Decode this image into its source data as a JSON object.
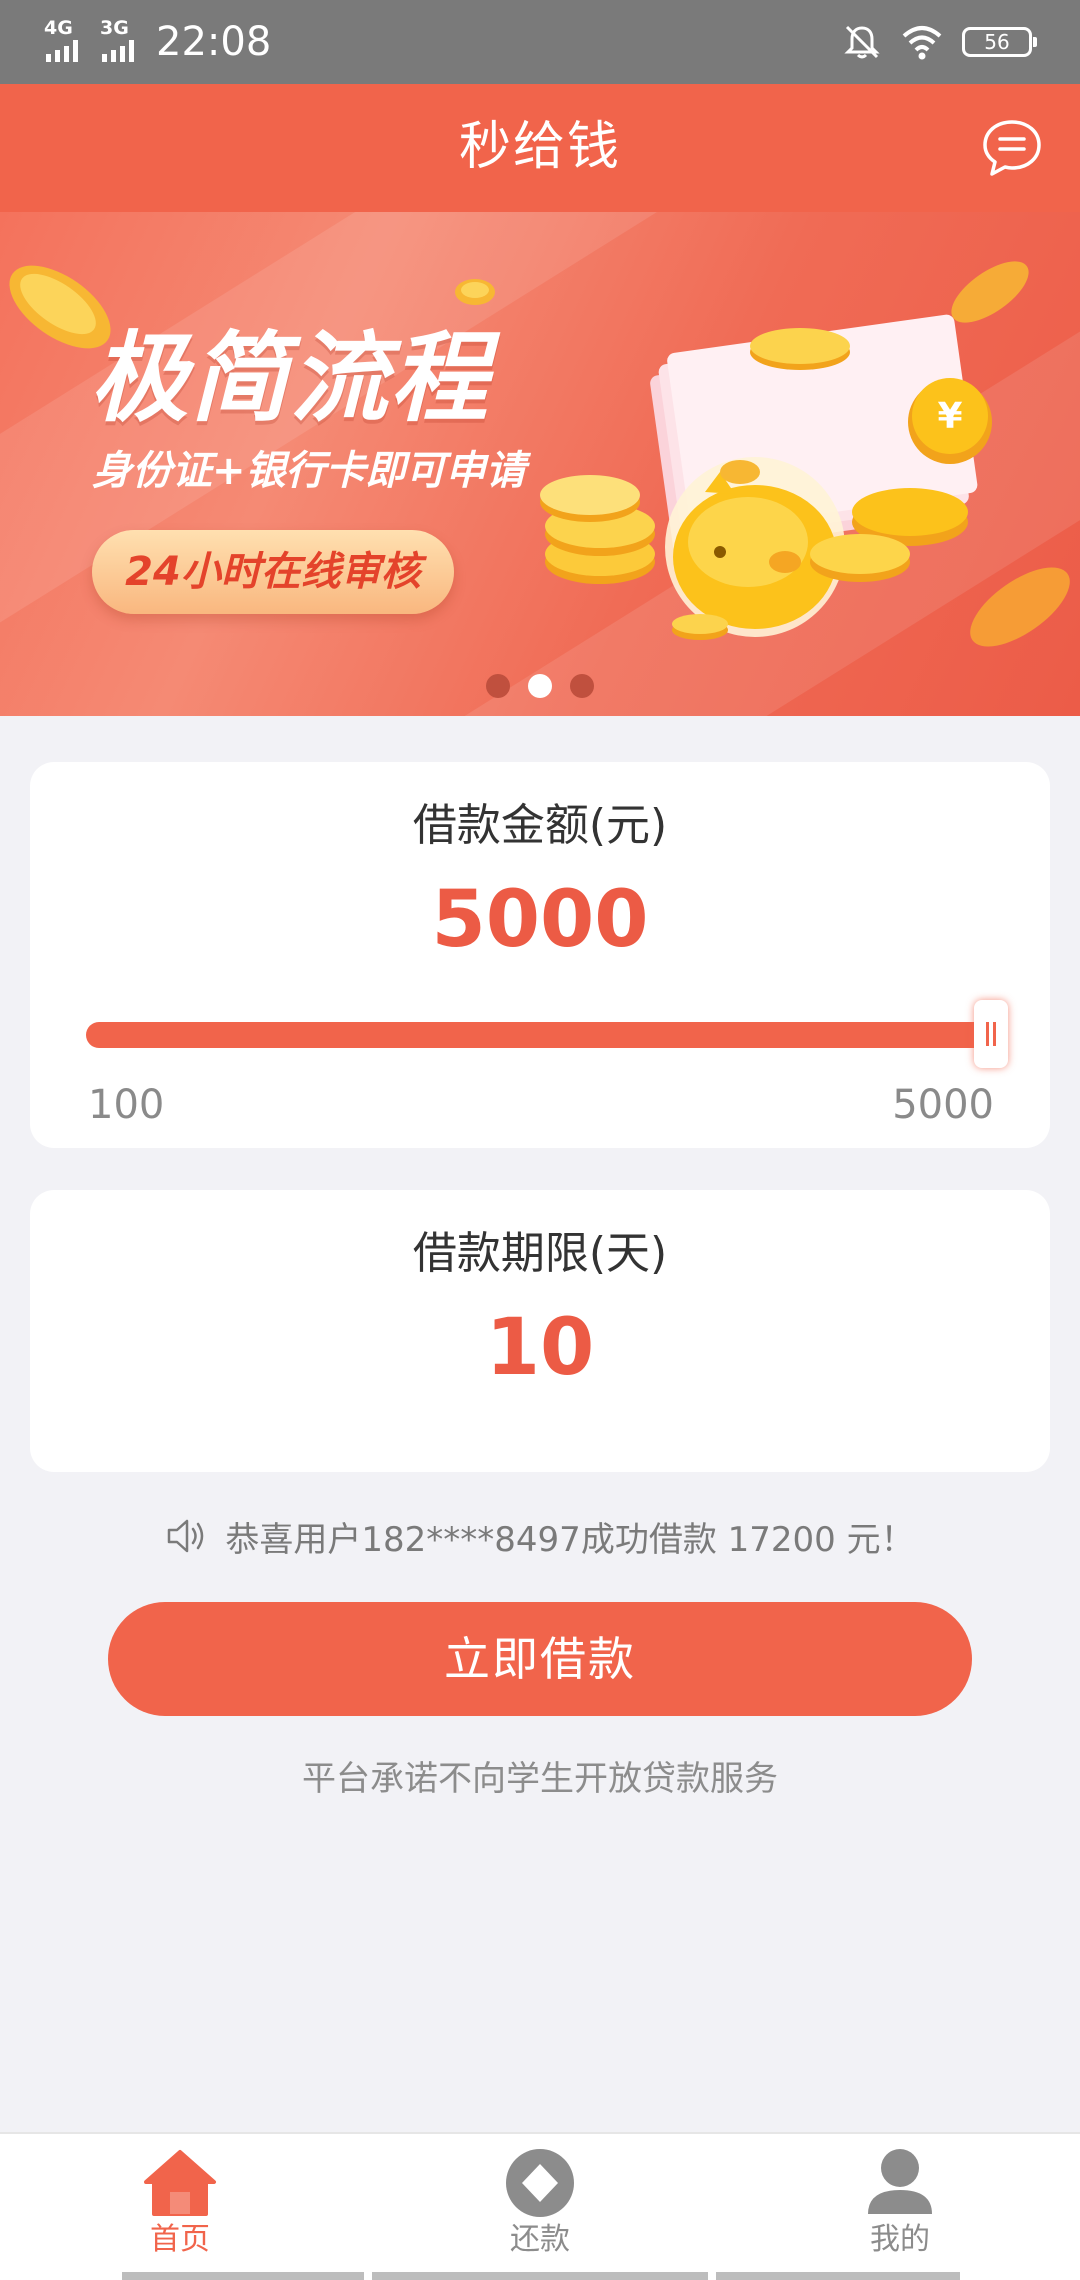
{
  "status_bar": {
    "network_1": "4G",
    "network_2": "3G",
    "time": "22:08",
    "battery": "56",
    "icons": [
      "signal-4g-icon",
      "signal-3g-icon",
      "bell-off-icon",
      "wifi-icon",
      "battery-icon"
    ]
  },
  "header": {
    "title": "秒给钱",
    "message_icon": "chat-bubble-icon"
  },
  "banner": {
    "title": "极简流程",
    "subtitle": "身份证+银行卡即可申请",
    "pill": "24小时在线审核",
    "slide_count": 3,
    "active_slide": 2
  },
  "amount_card": {
    "label": "借款金额(元)",
    "value": "5000",
    "slider_min": "100",
    "slider_max": "5000",
    "slider_fraction": 1.0
  },
  "term_card": {
    "label": "借款期限(天)",
    "value": "10"
  },
  "notice": {
    "icon": "speaker-icon",
    "text": "恭喜用户182****8497成功借款 17200 元！"
  },
  "apply_button": "立即借款",
  "disclaimer": "平台承诺不向学生开放贷款服务",
  "bottom_nav": {
    "items": [
      {
        "label": "首页",
        "icon": "home-icon",
        "active": true
      },
      {
        "label": "还款",
        "icon": "repay-icon",
        "active": false
      },
      {
        "label": "我的",
        "icon": "user-icon",
        "active": false
      }
    ]
  },
  "colors": {
    "accent": "#f1644b",
    "value_red": "#ec5b45",
    "status_bar": "#7a7a7a",
    "background": "#f2f2f6",
    "inactive": "#8c8c8c"
  }
}
